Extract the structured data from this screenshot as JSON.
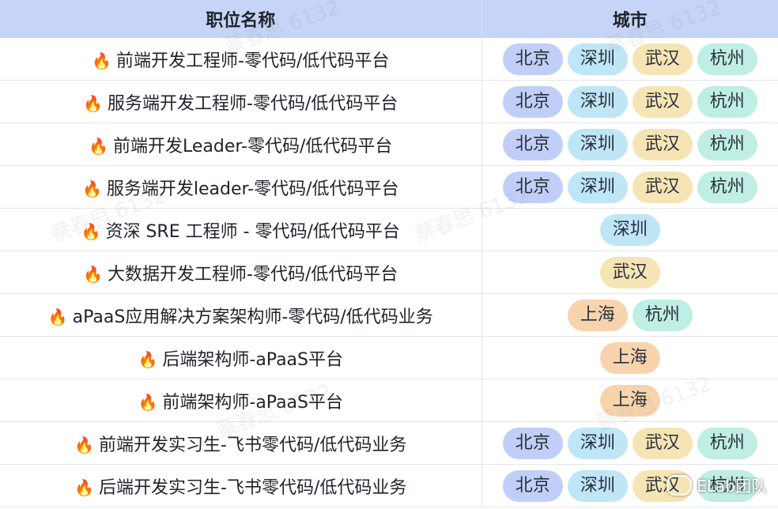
{
  "headers": {
    "position": "职位名称",
    "city": "城市"
  },
  "fire_glyph": "🔥",
  "rows": [
    {
      "title": "前端开发工程师-零代码/低代码平台",
      "cities": [
        "北京",
        "深圳",
        "武汉",
        "杭州"
      ]
    },
    {
      "title": "服务端开发工程师-零代码/低代码平台",
      "cities": [
        "北京",
        "深圳",
        "武汉",
        "杭州"
      ]
    },
    {
      "title": "前端开发Leader-零代码/低代码平台",
      "cities": [
        "北京",
        "深圳",
        "武汉",
        "杭州"
      ]
    },
    {
      "title": "服务端开发leader-零代码/低代码平台",
      "cities": [
        "北京",
        "深圳",
        "武汉",
        "杭州"
      ]
    },
    {
      "title": "资深 SRE 工程师 - 零代码/低代码平台",
      "cities": [
        "深圳"
      ]
    },
    {
      "title": "大数据开发工程师-零代码/低代码平台",
      "cities": [
        "武汉"
      ]
    },
    {
      "title": "aPaaS应用解决方案架构师-零代码/低代码业务",
      "cities": [
        "上海",
        "杭州"
      ]
    },
    {
      "title": "后端架构师-aPaaS平台",
      "cities": [
        "上海"
      ]
    },
    {
      "title": "前端架构师-aPaaS平台",
      "cities": [
        "上海"
      ]
    },
    {
      "title": "前端开发实习生-飞书零代码/低代码业务",
      "cities": [
        "北京",
        "深圳",
        "武汉",
        "杭州"
      ]
    },
    {
      "title": "后端开发实习生-飞书零代码/低代码业务",
      "cities": [
        "北京",
        "深圳",
        "武汉",
        "杭州"
      ]
    }
  ],
  "city_colors": {
    "北京": "#c1cff8",
    "深圳": "#bfe6f7",
    "武汉": "#f5e5b4",
    "杭州": "#bfeee3",
    "上海": "#f8d4ad"
  },
  "watermark_text": "蔡春思 6132",
  "brand_text": "ELab团队"
}
